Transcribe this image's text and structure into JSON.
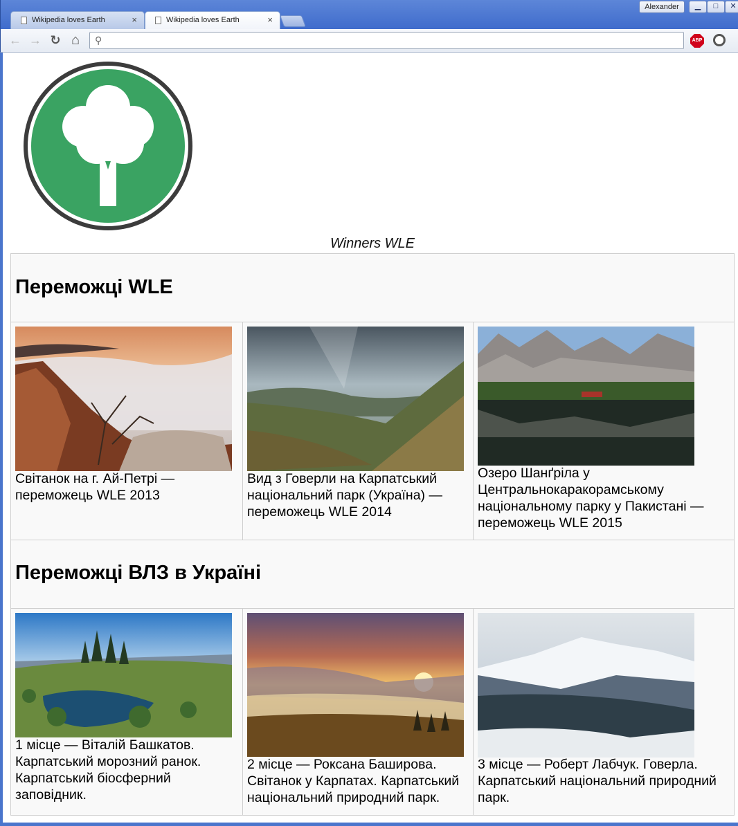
{
  "browser": {
    "tabs": [
      {
        "title": "Wikipedia loves Earth",
        "close": "×"
      },
      {
        "title": "Wikipedia loves Earth",
        "close": "×"
      }
    ],
    "user": "Alexander",
    "window_buttons": {
      "minimize": "▁",
      "maximize": "□",
      "close": "✕"
    },
    "nav": {
      "back": "←",
      "forward": "→",
      "reload": "↻",
      "home": "⌂"
    },
    "address": {
      "value": "",
      "placeholder": ""
    },
    "extensions": {
      "adblock": "ABP"
    }
  },
  "page": {
    "logo_icon": "tree-in-circle-icon",
    "caption": "Winners WLE",
    "sections": [
      {
        "heading": "Переможці WLE",
        "items": [
          {
            "photo": "sunrise-ai-petri-photo",
            "text": "Світанок на г. Ай-Петрі — переможець WLE 2013"
          },
          {
            "photo": "hoverla-view-photo",
            "text": "Вид з Говерли на Карпатський національний парк (Україна) — переможець WLE 2014"
          },
          {
            "photo": "shangrila-lake-photo",
            "text": "Озеро Шанґріла у Центральнокаракорамському національному парку у Пакистані — переможець WLE 2015"
          }
        ]
      },
      {
        "heading": "Переможці ВЛЗ в Україні",
        "items": [
          {
            "photo": "frosty-morning-photo",
            "text": "1 місце — Віталій Башкатов. Карпатський морозний ранок. Карпатський біосферний заповідник."
          },
          {
            "photo": "carpathian-sunrise-photo",
            "text": "2 місце — Роксана Баширова. Світанок у Карпатах. Карпатський національний природний парк."
          },
          {
            "photo": "hoverla-winter-photo",
            "text": "3 місце — Роберт Лабчук. Говерла. Карпатський національний природний парк."
          }
        ]
      }
    ]
  },
  "colors": {
    "logo_green": "#3aa362",
    "logo_ring": "#3c3c3c",
    "chrome_blue": "#3f6ccc"
  }
}
